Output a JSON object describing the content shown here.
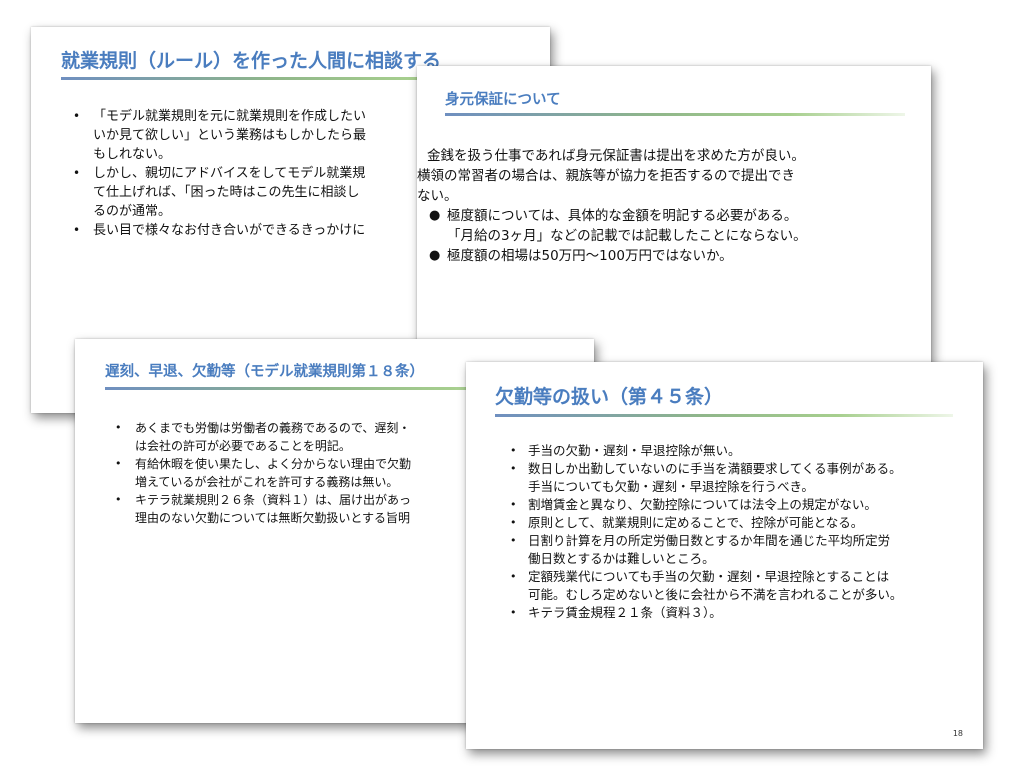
{
  "bullet_symbol": "•",
  "solid_bullet_symbol": "●",
  "slide1": {
    "title": "就業規則（ルール）を作った人間に相談する",
    "items": [
      [
        "「モデル就業規則を元に就業規則を作成したい",
        "いか見て欲しい」という業務はもしかしたら最",
        "もしれない。"
      ],
      [
        "しかし、親切にアドバイスをしてモデル就業規",
        "て仕上げれば、「困った時はこの先生に相談し",
        "るのが通常。"
      ],
      [
        "長い目で様々なお付き合いができるきっかけに"
      ]
    ]
  },
  "slide2": {
    "title": "身元保証について",
    "items": [
      {
        "lines": [
          "金銭を扱う仕事であれば身元保証書は提出を求めた方が良い。"
        ],
        "style": "first"
      },
      {
        "lines": [
          "横領の常習者の場合は、親族等が協力を拒否するので提出でき",
          "ない。"
        ],
        "style": "noind"
      },
      {
        "lines": [
          "極度額については、具体的な金額を明記する必要がある。",
          "「月給の3ヶ月」などの記載では記載したことにならない。"
        ],
        "style": "ind"
      },
      {
        "lines": [
          "極度額の相場は50万円～100万円ではないか。"
        ],
        "style": "ind"
      }
    ]
  },
  "slide3": {
    "title": "遅刻、早退、欠勤等（モデル就業規則第１８条）",
    "items": [
      [
        "あくまでも労働は労働者の義務であるので、遅刻・",
        "は会社の許可が必要であることを明記。"
      ],
      [
        "有給休暇を使い果たし、よく分からない理由で欠勤",
        "増えているが会社がこれを許可する義務は無い。"
      ],
      [
        "キテラ就業規則２６条（資料１）は、届け出があっ",
        "理由のない欠勤については無断欠勤扱いとする旨明"
      ]
    ]
  },
  "slide4": {
    "title": "欠勤等の扱い（第４５条）",
    "page_number": "18",
    "items": [
      [
        "手当の欠勤・遅刻・早退控除が無い。"
      ],
      [
        "数日しか出勤していないのに手当を満額要求してくる事例がある。",
        "手当についても欠勤・遅刻・早退控除を行うべき。"
      ],
      [
        "割増賃金と異なり、欠勤控除については法令上の規定がない。"
      ],
      [
        "原則として、就業規則に定めることで、控除が可能となる。"
      ],
      [
        "日割り計算を月の所定労働日数とするか年間を通じた平均所定労",
        "働日数とするかは難しいところ。"
      ],
      [
        "定額残業代についても手当の欠勤・遅刻・早退控除とすることは",
        "可能。むしろ定めないと後に会社から不満を言われることが多い。"
      ],
      [
        "キテラ賃金規程２１条（資料３）。"
      ]
    ]
  }
}
